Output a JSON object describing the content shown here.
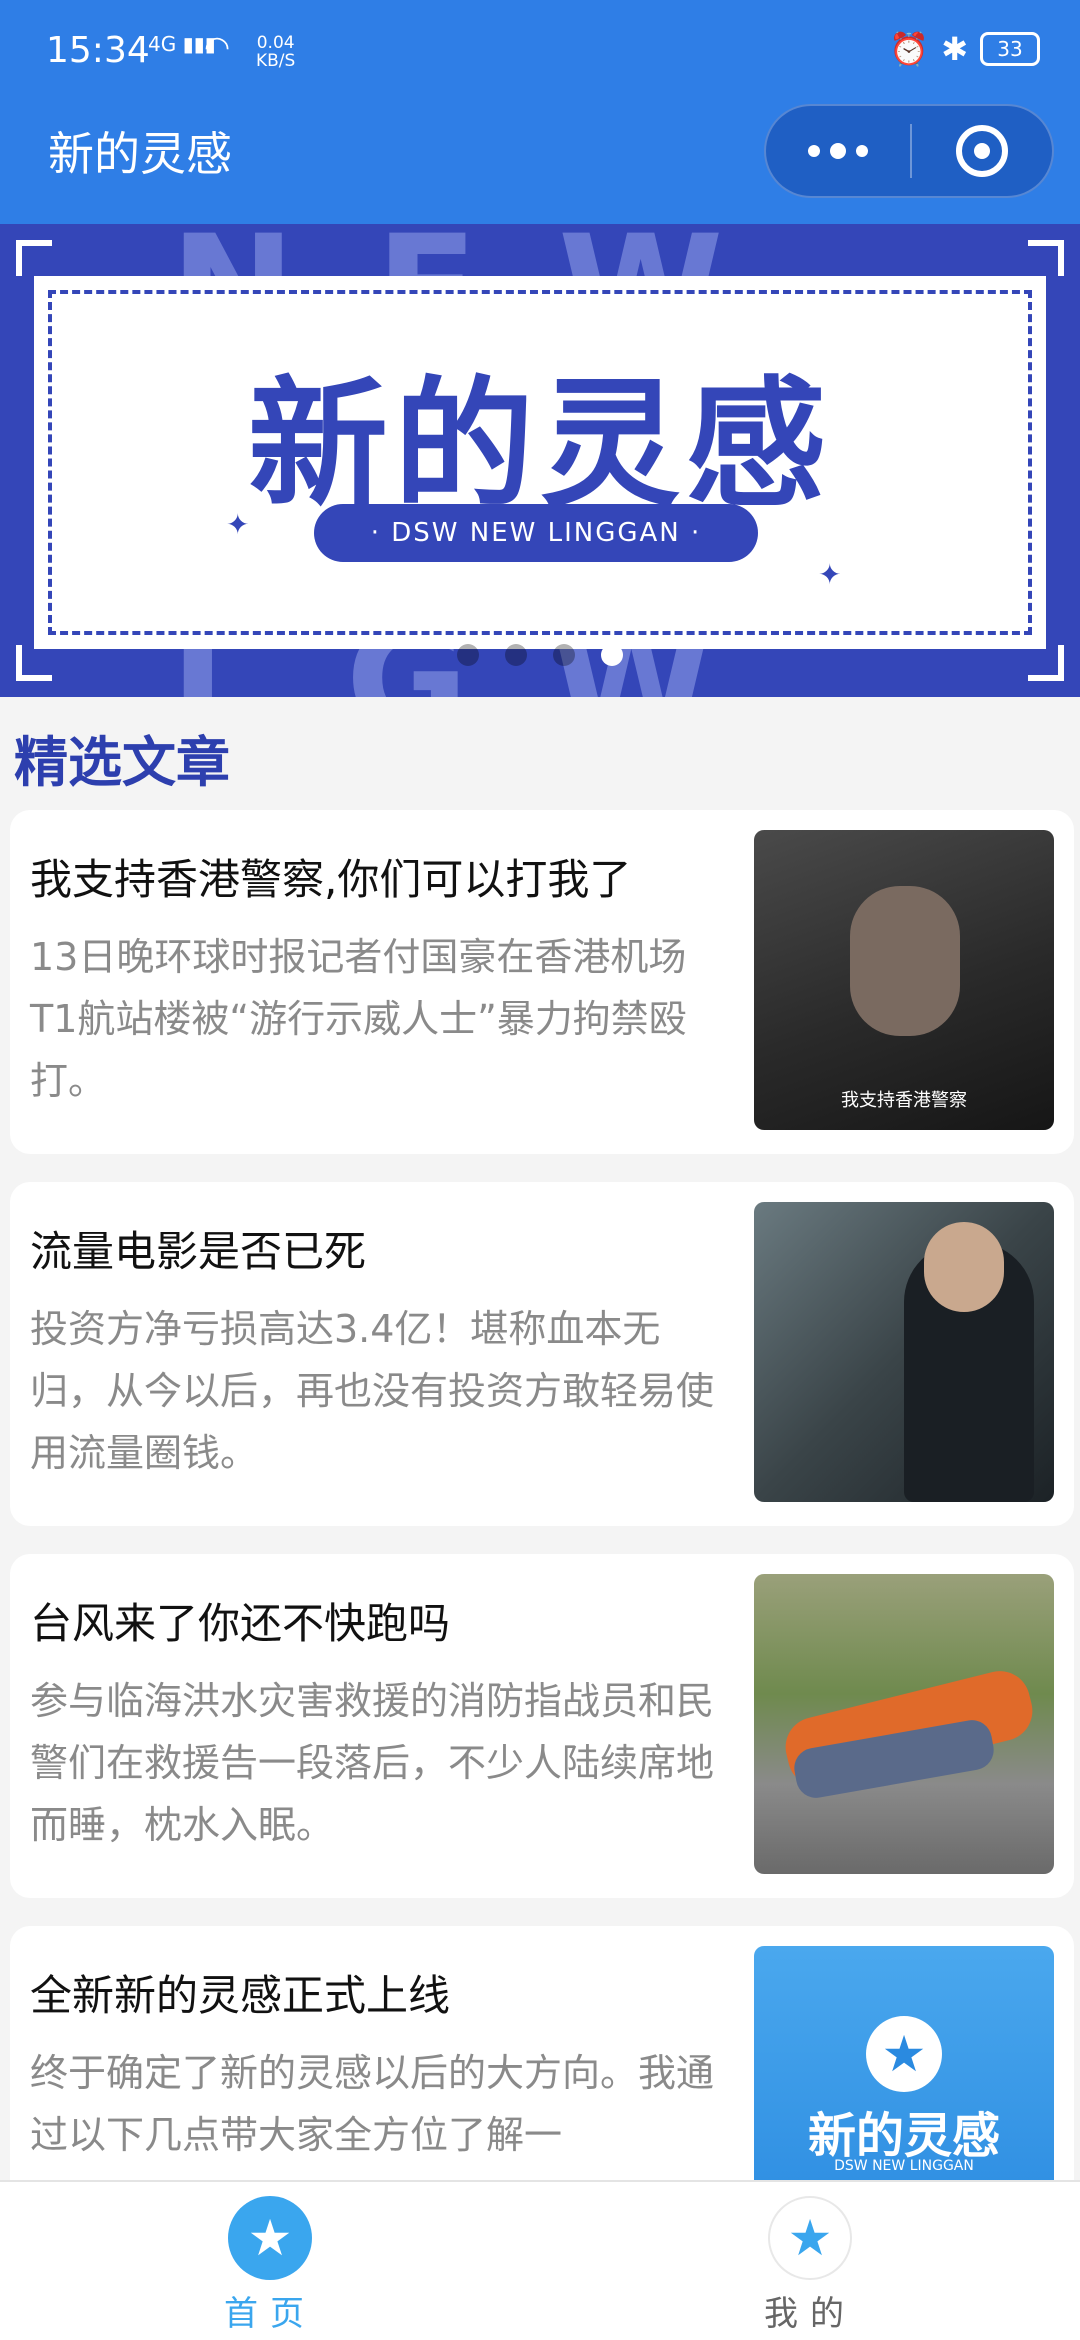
{
  "status": {
    "time": "15:34",
    "network": "4G",
    "speed_value": "0.04",
    "speed_unit": "KB/S",
    "battery": "33"
  },
  "nav": {
    "title": "新的灵感"
  },
  "banner": {
    "bg_word_top": "NEW",
    "bg_word_bottom": "LGW",
    "title": "新的灵感",
    "subtitle": "· DSW NEW LINGGAN ·",
    "page_count": 4,
    "active_index": 3
  },
  "section": {
    "title": "精选文章"
  },
  "articles": [
    {
      "title": "我支持香港警察,你们可以打我了",
      "summary": "13日晚环球时报记者付国豪在香港机场T1航站楼被“游行示威人士”暴力拘禁殴打。",
      "thumb_caption": "我支持香港警察"
    },
    {
      "title": "流量电影是否已死",
      "summary": "投资方净亏损高达3.4亿！堪称血本无归，从今以后，再也没有投资方敢轻易使用流量圈钱。"
    },
    {
      "title": "台风来了你还不快跑吗",
      "summary": "参与临海洪水灾害救援的消防指战员和民警们在救援告一段落后，不少人陆续席地而睡，枕水入眠。"
    },
    {
      "title": "全新新的灵感正式上线",
      "summary": "终于确定了新的灵感以后的大方向。我通过以下几点带大家全方位了解一",
      "thumb_title": "新的灵感",
      "thumb_sub": "DSW NEW LINGGAN"
    }
  ],
  "tabbar": {
    "home": "首页",
    "mine": "我的"
  },
  "colors": {
    "primary": "#2f7ee6",
    "banner": "#3446b8",
    "accent": "#3aa6ee"
  }
}
